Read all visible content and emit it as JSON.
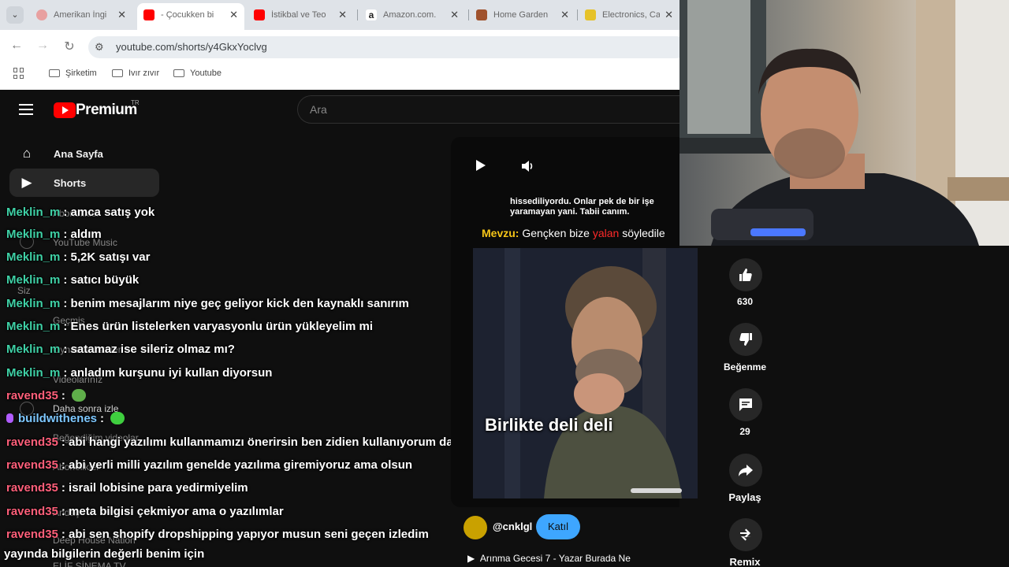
{
  "browser": {
    "tabs": [
      {
        "title": "Amerikan İngi",
        "favicon_color": "#e8a0a0"
      },
      {
        "title": "- Çocukken bi",
        "favicon_color": "#ff0000"
      },
      {
        "title": "İstikbal ve Teo",
        "favicon_color": "#ff0000"
      },
      {
        "title": "Amazon.com.",
        "favicon_color": "#222222"
      },
      {
        "title": "Home Garden",
        "favicon_color": "#a0522d"
      },
      {
        "title": "Electronics, Ca",
        "favicon_color": "#e6c229"
      }
    ],
    "active_tab_index": 1,
    "url": "youtube.com/shorts/y4GkxYoclvg",
    "bookmarks": [
      "Şirketim",
      "Ivır zıvır",
      "Youtube"
    ]
  },
  "youtube": {
    "brand": "Premium",
    "region": "TR",
    "search_placeholder": "Ara",
    "sidebar": [
      {
        "label": "Ana Sayfa",
        "icon": "home-icon",
        "active": false
      },
      {
        "label": "Shorts",
        "icon": "shorts-icon",
        "active": true
      }
    ],
    "sidebar_faded": [
      "Abonelikler",
      "YouTube Music",
      "Siz",
      "Geçmiş",
      "Oynatma listeleri",
      "Videolarınız",
      "Daha sonra izle",
      "Beğendiğim videolar",
      "Abonelikler",
      "Andaç",
      "Deep House Nation",
      "ELİF SİNEMA TV"
    ]
  },
  "chat": [
    {
      "user": "Meklin_m",
      "user_color": "#3fd1a6",
      "message": "amca satış yok"
    },
    {
      "user": "Meklin_m",
      "user_color": "#3fd1a6",
      "message": "aldım"
    },
    {
      "user": "Meklin_m",
      "user_color": "#3fd1a6",
      "message": "5,2K satışı var"
    },
    {
      "user": "Meklin_m",
      "user_color": "#3fd1a6",
      "message": "satıcı büyük"
    },
    {
      "user": "Meklin_m",
      "user_color": "#3fd1a6",
      "message": "benim mesajlarım niye geç geliyor kick den kaynaklı sanırım"
    },
    {
      "user": "Meklin_m",
      "user_color": "#3fd1a6",
      "message": "Enes ürün listelerken varyasyonlu ürün yükleyelim mi"
    },
    {
      "user": "Meklin_m",
      "user_color": "#3fd1a6",
      "message": "satamaz ise sileriz olmaz mı?"
    },
    {
      "user": "Meklin_m",
      "user_color": "#3fd1a6",
      "message": "anladım kurşunu iyi kullan diyorsun"
    },
    {
      "user": "ravend35",
      "user_color": "#ff5f7a",
      "message": ""
    },
    {
      "user": "buildwithenes",
      "user_color": "#7ec8ff",
      "message": ""
    },
    {
      "user": "ravend35",
      "user_color": "#ff5f7a",
      "message": "abi hangi yazılımı kullanmamızı önerirsin ben zidien kullanıyorum da"
    },
    {
      "user": "ravend35",
      "user_color": "#ff5f7a",
      "message": "abi yerli milli yazılım genelde yazılıma giremiyoruz ama olsun"
    },
    {
      "user": "ravend35",
      "user_color": "#ff5f7a",
      "message": "israil lobisine para yedirmiyelim"
    },
    {
      "user": "ravend35",
      "user_color": "#ff5f7a",
      "message": "meta bilgisi çekmiyor ama o yazılımlar"
    },
    {
      "user": "ravend35",
      "user_color": "#ff5f7a",
      "message": "abi sen shopify dropshipping yapıyor musun seni geçen izledim"
    },
    {
      "user": "",
      "user_color": "#ffffff",
      "message": "yayında bilgilerin değerli benim için"
    }
  ],
  "short": {
    "subtitle_top": "hissediliyordu. Onlar pek de bir işe yaramayan yani. Tabii canım.",
    "mevzu_label": "Mevzu:",
    "mevzu_text_1": "Gençken bize",
    "mevzu_highlight": "yalan",
    "mevzu_text_2": "söyledile",
    "caption": "Birlikte deli deli",
    "channel": "@cnklgl",
    "join_label": "Katıl",
    "next_title": "Arınma Gecesi 7 - Yazar Burada Ne",
    "actions": [
      {
        "icon": "like-icon",
        "label": "630"
      },
      {
        "icon": "dislike-icon",
        "label": "Beğenme"
      },
      {
        "icon": "comment-icon",
        "label": "29"
      },
      {
        "icon": "share-icon",
        "label": "Paylaş"
      },
      {
        "icon": "remix-icon",
        "label": "Remix"
      }
    ]
  }
}
